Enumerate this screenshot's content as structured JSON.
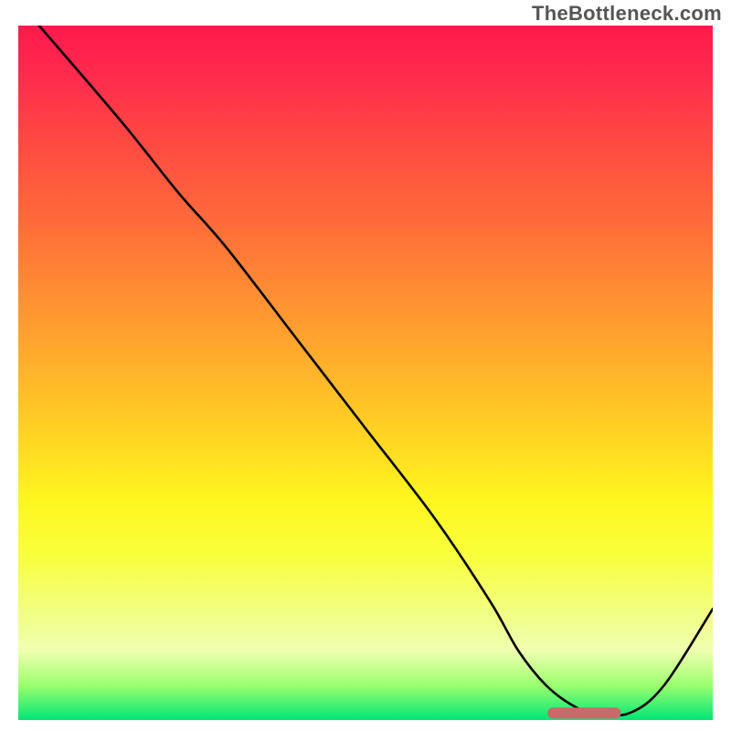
{
  "watermark": "TheBottleneck.com",
  "colors": {
    "gradient_top": "#ff1a4d",
    "gradient_mid_upper": "#ff8c34",
    "gradient_mid": "#fff51e",
    "gradient_lower": "#9cff6e",
    "gradient_bottom": "#00e676",
    "curve_stroke": "#000000",
    "marker_stroke": "#c76a6a"
  },
  "chart_data": {
    "type": "line",
    "title": "",
    "xlabel": "",
    "ylabel": "",
    "xlim": [
      0,
      100
    ],
    "ylim": [
      0,
      100
    ],
    "grid": false,
    "legend": null,
    "series": [
      {
        "name": "curve",
        "x": [
          3,
          15,
          23,
          30,
          40,
          50,
          60,
          68,
          72,
          76,
          80,
          83,
          88,
          93,
          100
        ],
        "values": [
          100,
          86,
          76,
          68,
          55,
          42,
          29,
          17,
          10,
          5,
          2,
          1,
          1,
          5,
          16
        ]
      }
    ],
    "annotations": [
      {
        "name": "optimal-marker",
        "type": "segment",
        "x_start": 77,
        "x_end": 86,
        "y": 1,
        "color": "#c76a6a"
      }
    ]
  }
}
